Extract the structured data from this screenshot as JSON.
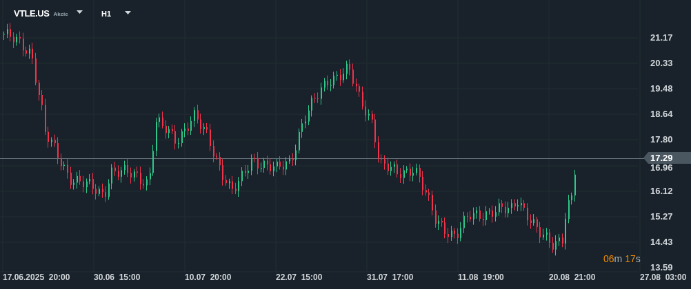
{
  "header": {
    "symbol": "VTLE.US",
    "asset_type": "Akcie",
    "timeframe": "H1"
  },
  "price_axis": [
    "21.17",
    "20.33",
    "19.48",
    "18.64",
    "17.80",
    "16.96",
    "16.12",
    "15.27",
    "14.43",
    "13.59"
  ],
  "time_axis": [
    {
      "date": "17.06.2025",
      "time": "20:00"
    },
    {
      "date": "30.06",
      "time": "15:00"
    },
    {
      "date": "10.07",
      "time": "20:00"
    },
    {
      "date": "22.07",
      "time": "15:00"
    },
    {
      "date": "31.07",
      "time": "17:00"
    },
    {
      "date": "11.08",
      "time": "19:00"
    },
    {
      "date": "20.08",
      "time": "21:00"
    },
    {
      "date": "27.08",
      "time": "03:00"
    }
  ],
  "current_price": "17.29",
  "countdown": {
    "minutes": "06",
    "minutes_unit": "m",
    "seconds": "17",
    "seconds_unit": "s"
  }
}
